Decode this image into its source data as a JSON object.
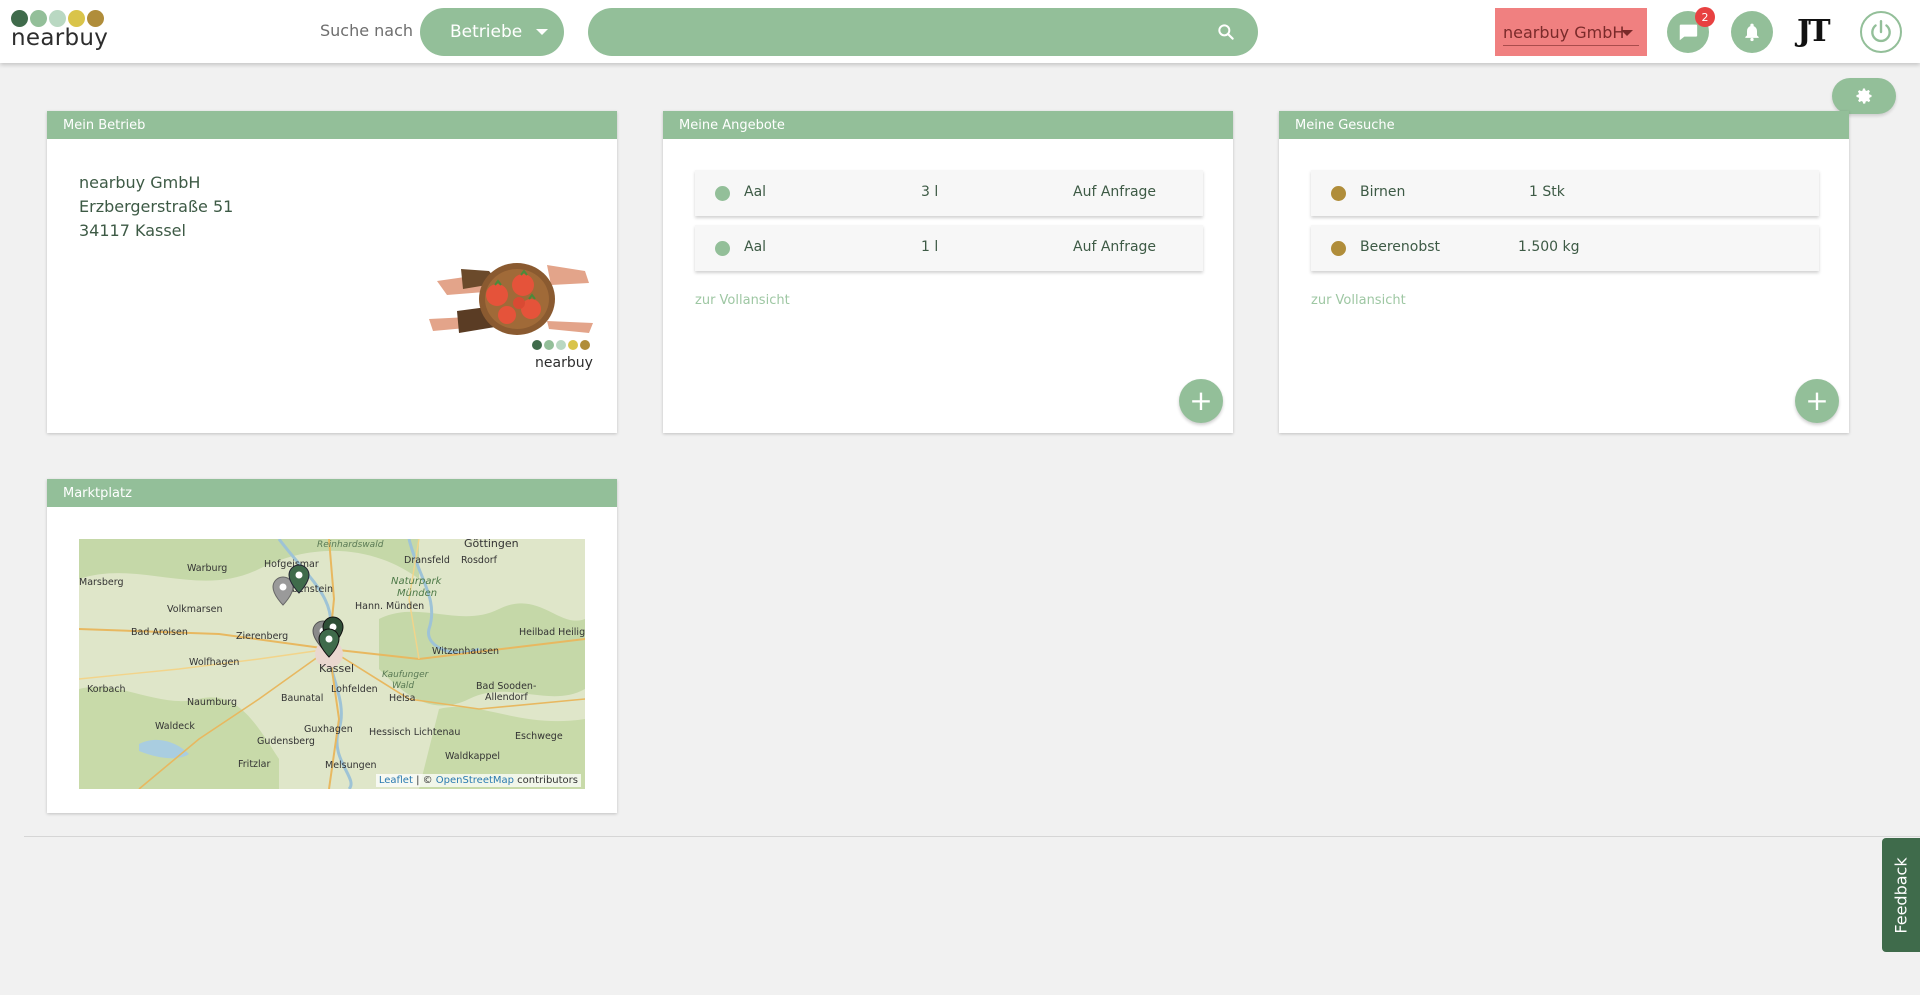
{
  "header": {
    "logo_text": "nearbuy",
    "logo_colors": [
      "#3f6b4b",
      "#93bf99",
      "#b9d8c2",
      "#d9c44a",
      "#b08d3a"
    ],
    "search_label": "Suche nach",
    "search_type": "Betriebe",
    "search_value": "",
    "company": "nearbuy GmbH",
    "messages_badge": "2",
    "user_initials": "JT"
  },
  "mein_betrieb": {
    "title": "Mein Betrieb",
    "name": "nearbuy GmbH",
    "street": "Erzbergerstraße 51",
    "city": "34117 Kassel",
    "logo_text": "nearbuy"
  },
  "angebote": {
    "title": "Meine Angebote",
    "items": [
      {
        "name": "Aal",
        "qty": "3 l",
        "price": "Auf Anfrage"
      },
      {
        "name": "Aal",
        "qty": "1 l",
        "price": "Auf Anfrage"
      }
    ],
    "dot_color": "#93bf99",
    "link": "zur Vollansicht",
    "add": "+"
  },
  "gesuche": {
    "title": "Meine Gesuche",
    "items": [
      {
        "name": "Birnen",
        "qty": "1 Stk"
      },
      {
        "name": "Beerenobst",
        "qty": "1.500 kg"
      }
    ],
    "dot_color": "#b08d3a",
    "link": "zur Vollansicht",
    "add": "+"
  },
  "marktplatz": {
    "title": "Marktplatz",
    "places": [
      "Göttingen",
      "Reinhardswald",
      "Dransfeld",
      "Rosdorf",
      "Warburg",
      "Hofgeismar",
      "Marsberg",
      "Naturpark",
      "Münden",
      "Grebenstein",
      "Hann. Münden",
      "Volkmarsen",
      "Bad Arolsen",
      "Zierenberg",
      "Heilbad Heiligenstadt",
      "Witzenhausen",
      "Wolfhagen",
      "Kassel",
      "Kaufunger",
      "Wald",
      "Korbach",
      "Lohfelden",
      "Helsa",
      "Bad Sooden-",
      "Allendorf",
      "Naumburg",
      "Baunatal",
      "Waldeck",
      "Guxhagen",
      "Hessisch Lichtenau",
      "Eschwege",
      "Gudensberg",
      "Waldkappel",
      "Fritzlar",
      "Melsungen"
    ],
    "attribution": {
      "leaflet": "Leaflet",
      "sep": " | © ",
      "osm": "OpenStreetMap",
      "suffix": " contributors"
    }
  },
  "feedback": "Feedback"
}
